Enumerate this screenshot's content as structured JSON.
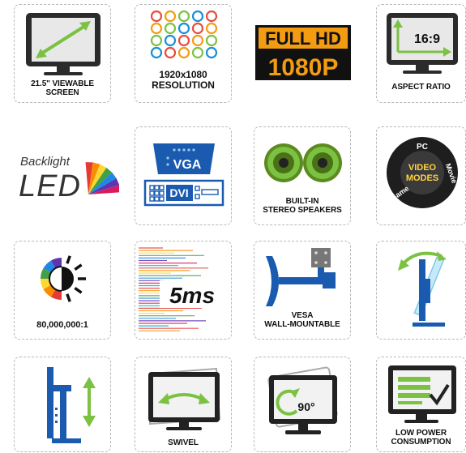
{
  "features": [
    {
      "id": "viewable-screen",
      "caption": "21.5\" VIEWABLE\nSCREEN",
      "icon": "monitor-diagonal-icon"
    },
    {
      "id": "resolution",
      "caption": "1920x1080\nRESOLUTION",
      "icon": "pixel-grid-icon"
    },
    {
      "id": "full-hd",
      "line1": "FULL HD",
      "line2": "1080P",
      "icon": "full-hd-badge-icon"
    },
    {
      "id": "aspect-ratio",
      "caption": "ASPECT RATIO",
      "ratio": "16:9",
      "icon": "aspect-ratio-monitor-icon"
    },
    {
      "id": "backlight-led",
      "small": "Backlight",
      "big": "LED",
      "icon": "rainbow-fan-icon"
    },
    {
      "id": "ports",
      "vga": "VGA",
      "dvi": "DVI",
      "icon": "vga-dvi-port-icon"
    },
    {
      "id": "speakers",
      "caption": "BUILT-IN\nSTEREO SPEAKERS",
      "icon": "speakers-icon"
    },
    {
      "id": "video-modes",
      "center": "VIDEO\nMODES",
      "ring": [
        "PC",
        "Movie",
        "Game"
      ],
      "icon": "mode-dial-icon"
    },
    {
      "id": "contrast",
      "caption": "80,000,000:1",
      "icon": "contrast-sun-icon"
    },
    {
      "id": "response-time",
      "value": "5ms",
      "icon": "speed-lines-icon"
    },
    {
      "id": "vesa",
      "caption": "VESA\nWALL-MOUNTABLE",
      "icon": "wall-mount-icon"
    },
    {
      "id": "tilt",
      "icon": "tilt-stand-icon"
    },
    {
      "id": "height",
      "icon": "height-adjust-icon"
    },
    {
      "id": "swivel",
      "caption": "SWIVEL",
      "icon": "swivel-monitor-icon"
    },
    {
      "id": "pivot",
      "degrees": "90°",
      "icon": "pivot-rotate-icon"
    },
    {
      "id": "power",
      "caption": "LOW POWER\nCONSUMPTION",
      "icon": "low-power-screen-icon"
    }
  ],
  "colors": {
    "blue": "#1a5bb0",
    "orange": "#f39c12",
    "green": "#7bc142",
    "dark": "#222222"
  }
}
